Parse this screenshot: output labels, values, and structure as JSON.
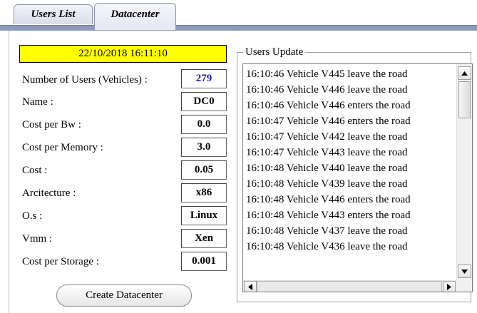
{
  "tabs": [
    {
      "label": "Users List"
    },
    {
      "label": "Datacenter"
    }
  ],
  "datacenter": {
    "timestamp": "22/10/2018 16:11:10",
    "rows": [
      {
        "label": "Number of Users (Vehicles) :",
        "value": "279"
      },
      {
        "label": "Name :",
        "value": "DC0"
      },
      {
        "label": "Cost per Bw :",
        "value": "0.0"
      },
      {
        "label": "Cost per Memory :",
        "value": "3.0"
      },
      {
        "label": "Cost :",
        "value": "0.05"
      },
      {
        "label": "Arcitecture :",
        "value": "x86"
      },
      {
        "label": "O.s :",
        "value": "Linux"
      },
      {
        "label": "Vmm :",
        "value": "Xen"
      },
      {
        "label": "Cost per Storage :",
        "value": "0.001"
      }
    ],
    "create_button": "Create Datacenter"
  },
  "users_update": {
    "title": "Users Update",
    "entries": [
      "16:10:46 Vehicle V445 leave the road",
      "16:10:46 Vehicle V446 leave the road",
      "16:10:46 Vehicle V446 enters the road",
      "16:10:47 Vehicle V446 enters the road",
      "16:10:47 Vehicle V442 leave the road",
      "16:10:47 Vehicle V443 leave the road",
      "16:10:48 Vehicle V440 leave the road",
      "16:10:48 Vehicle V439 leave the road",
      "16:10:48 Vehicle V446 enters the road",
      "16:10:48 Vehicle V443 enters the road",
      "16:10:48 Vehicle V437 leave the road",
      "16:10:48 Vehicle V436 leave the road"
    ]
  },
  "icons": {
    "scroll_up": "arrow-up-icon",
    "scroll_down": "arrow-down-icon",
    "scroll_left": "arrow-left-icon",
    "scroll_right": "arrow-right-icon"
  },
  "colors": {
    "timestamp_bg": "#ffff00",
    "users_count": "#1a1aa0",
    "tab_strip": "#8e9ab9"
  }
}
